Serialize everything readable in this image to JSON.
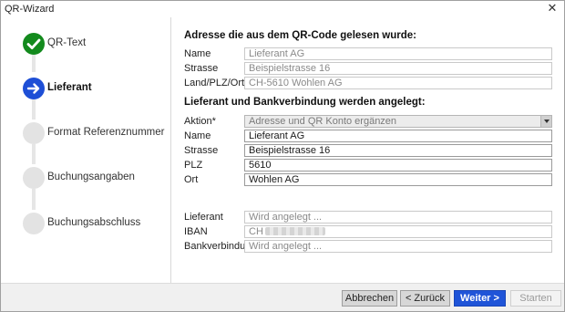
{
  "window": {
    "title": "QR-Wizard",
    "close_icon": "close-icon"
  },
  "colors": {
    "done": "#138a1d",
    "active": "#1e4fd6",
    "pending": "#e3e3e3",
    "primary_button": "#1f54d8"
  },
  "steps": [
    {
      "label": "QR-Text",
      "state": "done",
      "icon": "checkmark-icon"
    },
    {
      "label": "Lieferant",
      "state": "active",
      "icon": "arrow-right-icon"
    },
    {
      "label": "Format Referenznummer",
      "state": "pending"
    },
    {
      "label": "Buchungsangaben",
      "state": "pending"
    },
    {
      "label": "Buchungsabschluss",
      "state": "pending"
    }
  ],
  "scanned": {
    "heading": "Adresse die aus dem QR-Code gelesen wurde:",
    "name_label": "Name",
    "name_value": "Lieferant AG",
    "street_label": "Strasse",
    "street_value": "Beispielstrasse 16",
    "city_label": "Land/PLZ/Ort",
    "city_value": "CH-5610 Wohlen AG"
  },
  "creation": {
    "heading": "Lieferant und Bankverbindung werden angelegt:",
    "action_label": "Aktion*",
    "action_value": "Adresse und QR Konto ergänzen",
    "name_label": "Name",
    "name_value": "Lieferant AG",
    "street_label": "Strasse",
    "street_value": "Beispielstrasse 16",
    "zip_label": "PLZ",
    "zip_value": "5610",
    "city_label": "Ort",
    "city_value": "Wohlen AG"
  },
  "status": {
    "supplier_label": "Lieferant",
    "supplier_value": "Wird angelegt ...",
    "iban_label": "IBAN",
    "iban_value": "CH",
    "bank_label": "Bankverbindung",
    "bank_value": "Wird angelegt ..."
  },
  "buttons": {
    "cancel": "Abbrechen",
    "back": "< Zurück",
    "next": "Weiter >",
    "start": "Starten"
  }
}
